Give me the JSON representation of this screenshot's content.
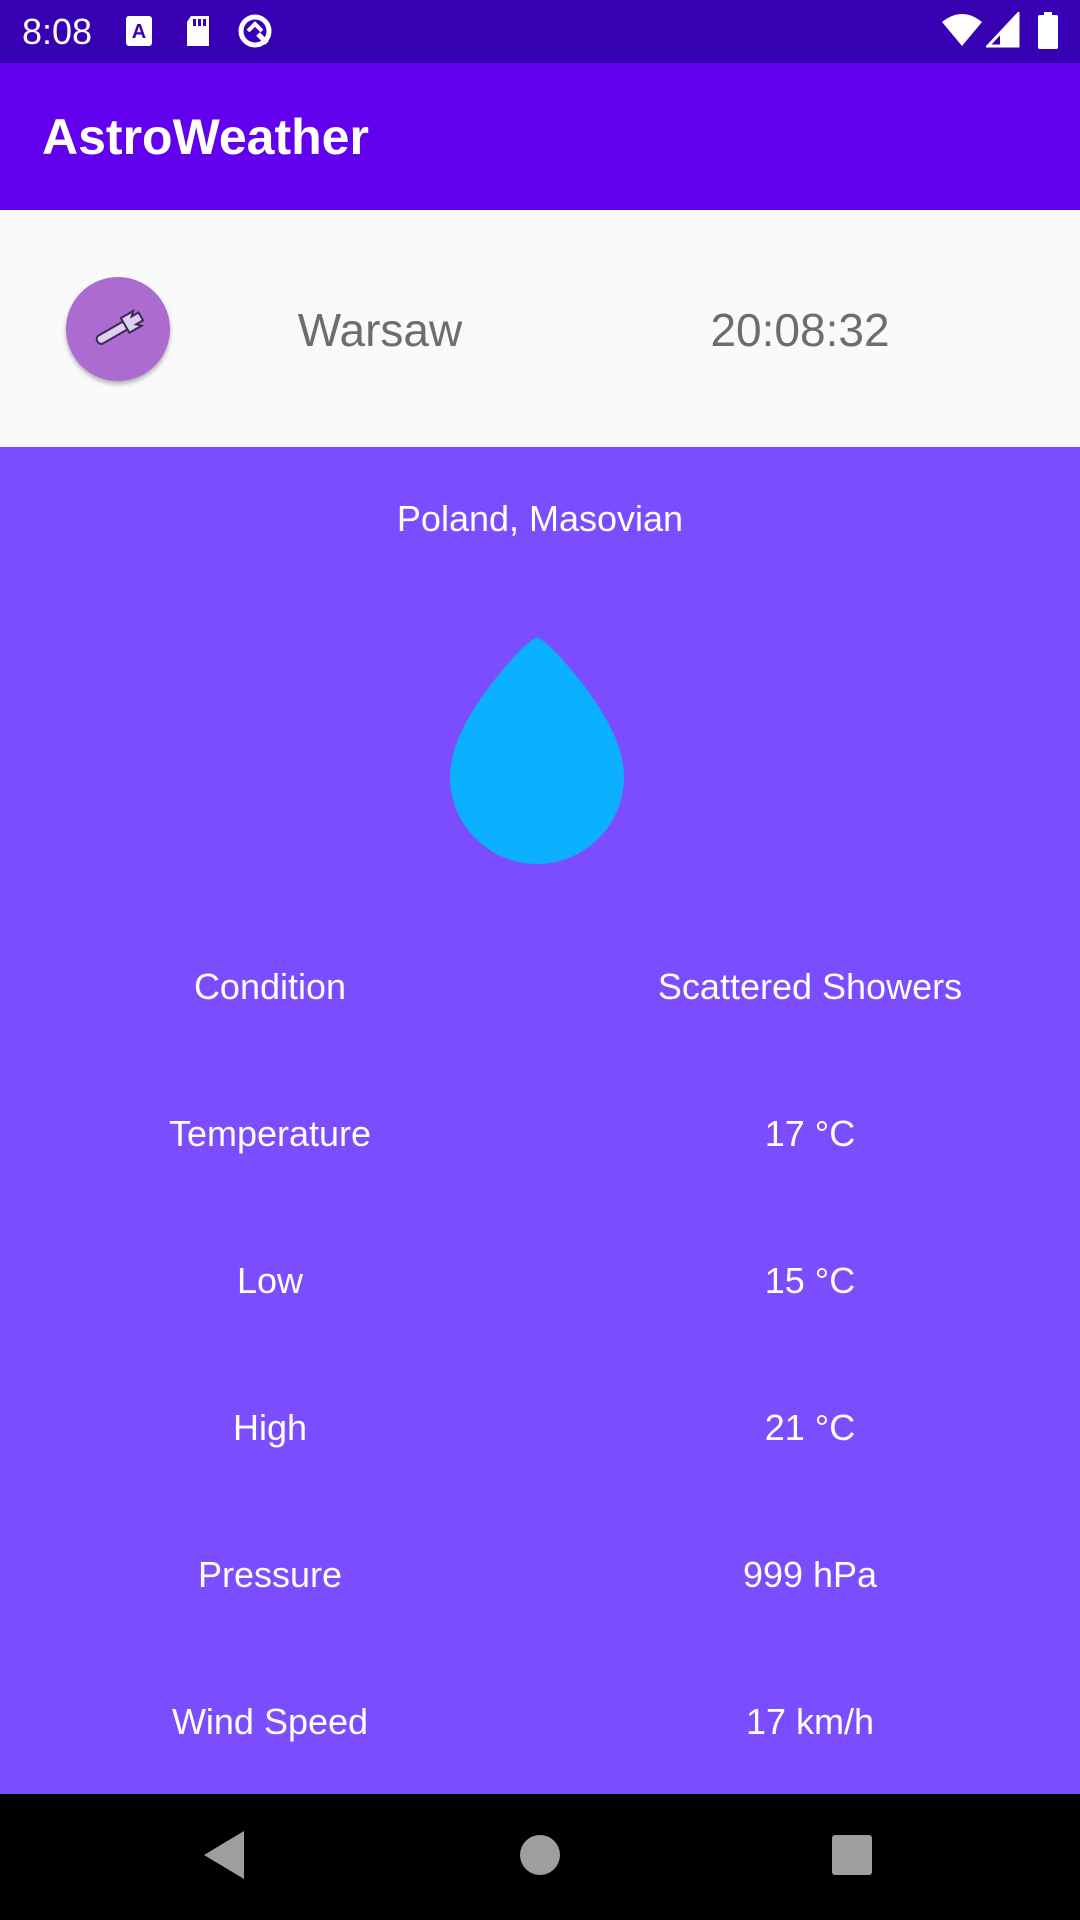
{
  "status_bar": {
    "time": "8:08",
    "left_icons": [
      "a-keyboard-icon",
      "sd-card-icon",
      "sync-icon"
    ],
    "right_icons": [
      "wifi-icon",
      "cell-signal-icon",
      "battery-icon"
    ]
  },
  "app_bar": {
    "title": "AstroWeather"
  },
  "header": {
    "settings_icon": "wrench-icon",
    "city": "Warsaw",
    "clock": "20:08:32"
  },
  "weather": {
    "region": "Poland,  Masovian",
    "condition_icon": "water-drop-icon",
    "rows": [
      {
        "label": "Condition",
        "value": "Scattered Showers"
      },
      {
        "label": "Temperature",
        "value": "17  °C"
      },
      {
        "label": "Low",
        "value": "15  °C"
      },
      {
        "label": "High",
        "value": "21  °C"
      },
      {
        "label": "Pressure",
        "value": "999 hPa"
      },
      {
        "label": "Wind Speed",
        "value": "17 km/h"
      }
    ]
  },
  "colors": {
    "status_bar": "#3700b3",
    "app_bar": "#6200ee",
    "content_bg": "#7c4dff",
    "settings_button": "#ab6bd1",
    "drop": "#0bb0ff"
  },
  "nav_bar": {
    "icons": [
      "back-icon",
      "home-icon",
      "recents-icon"
    ]
  }
}
